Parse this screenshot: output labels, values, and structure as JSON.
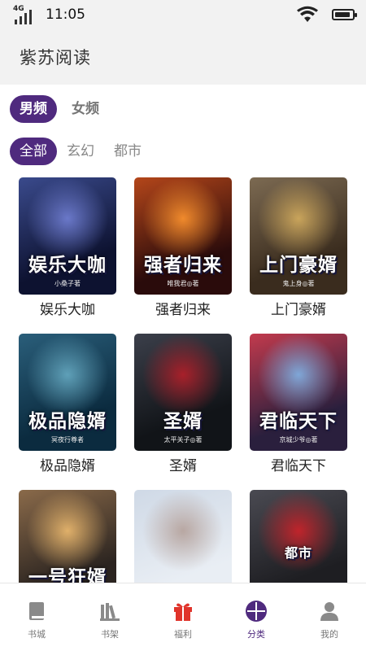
{
  "status": {
    "network": "4G",
    "time": "11:05",
    "battery_level": 0.9
  },
  "header": {
    "title": "紫苏阅读"
  },
  "tabs": [
    {
      "label": "男频",
      "active": true
    },
    {
      "label": "女频",
      "active": false
    }
  ],
  "categories": [
    {
      "label": "全部",
      "active": true
    },
    {
      "label": "玄幻",
      "active": false
    },
    {
      "label": "都市",
      "active": false
    }
  ],
  "books": [
    {
      "title": "娱乐大咖",
      "cover_text": "娱乐大咖",
      "cover_author": "小桑子著",
      "palette": [
        "#0d1230",
        "#3a4a8c",
        "#6a78c9"
      ]
    },
    {
      "title": "强者归来",
      "cover_text": "强者归来",
      "cover_author": "唯我君◎著",
      "palette": [
        "#2a0b0b",
        "#b4461a",
        "#f08a2c"
      ]
    },
    {
      "title": "上门豪婿",
      "cover_text": "上门豪婿",
      "cover_author": "鬼上身◎著",
      "palette": [
        "#3a2c1e",
        "#7c6a52",
        "#c9a45b"
      ]
    },
    {
      "title": "极品隐婿",
      "cover_text": "极品隐婿",
      "cover_author": "冥夜行尊者",
      "palette": [
        "#0b2b3f",
        "#2a5e7a",
        "#5fa0b8"
      ]
    },
    {
      "title": "圣婿",
      "cover_text": "圣婿",
      "cover_author": "太平关子◎著",
      "palette": [
        "#111418",
        "#3b3f4a",
        "#a8202a"
      ]
    },
    {
      "title": "君临天下",
      "cover_text": "君临天下",
      "cover_author": "京城少爷◎著",
      "palette": [
        "#2a1f3d",
        "#c23a4d",
        "#7fa7d8"
      ]
    },
    {
      "title": "",
      "cover_text": "一号狂婿",
      "cover_author": "",
      "palette": [
        "#2b2420",
        "#8a6a4a",
        "#e0b06a"
      ]
    },
    {
      "title": "",
      "cover_text": "",
      "cover_author": "",
      "palette": [
        "#e9eef4",
        "#cfd9e6",
        "#b8a7a2"
      ]
    },
    {
      "title": "",
      "cover_text": "都市",
      "cover_author": "",
      "palette": [
        "#1e1e22",
        "#4a4a52",
        "#c0242b"
      ]
    }
  ],
  "bottom_nav": [
    {
      "label": "书城",
      "icon": "book-icon",
      "active": false
    },
    {
      "label": "书架",
      "icon": "bookshelf-icon",
      "active": false
    },
    {
      "label": "福利",
      "icon": "gift-icon",
      "active": false
    },
    {
      "label": "分类",
      "icon": "category-icon",
      "active": true
    },
    {
      "label": "我的",
      "icon": "profile-icon",
      "active": false
    }
  ],
  "colors": {
    "accent": "#4f2a7e",
    "gift": "#e0342b"
  }
}
